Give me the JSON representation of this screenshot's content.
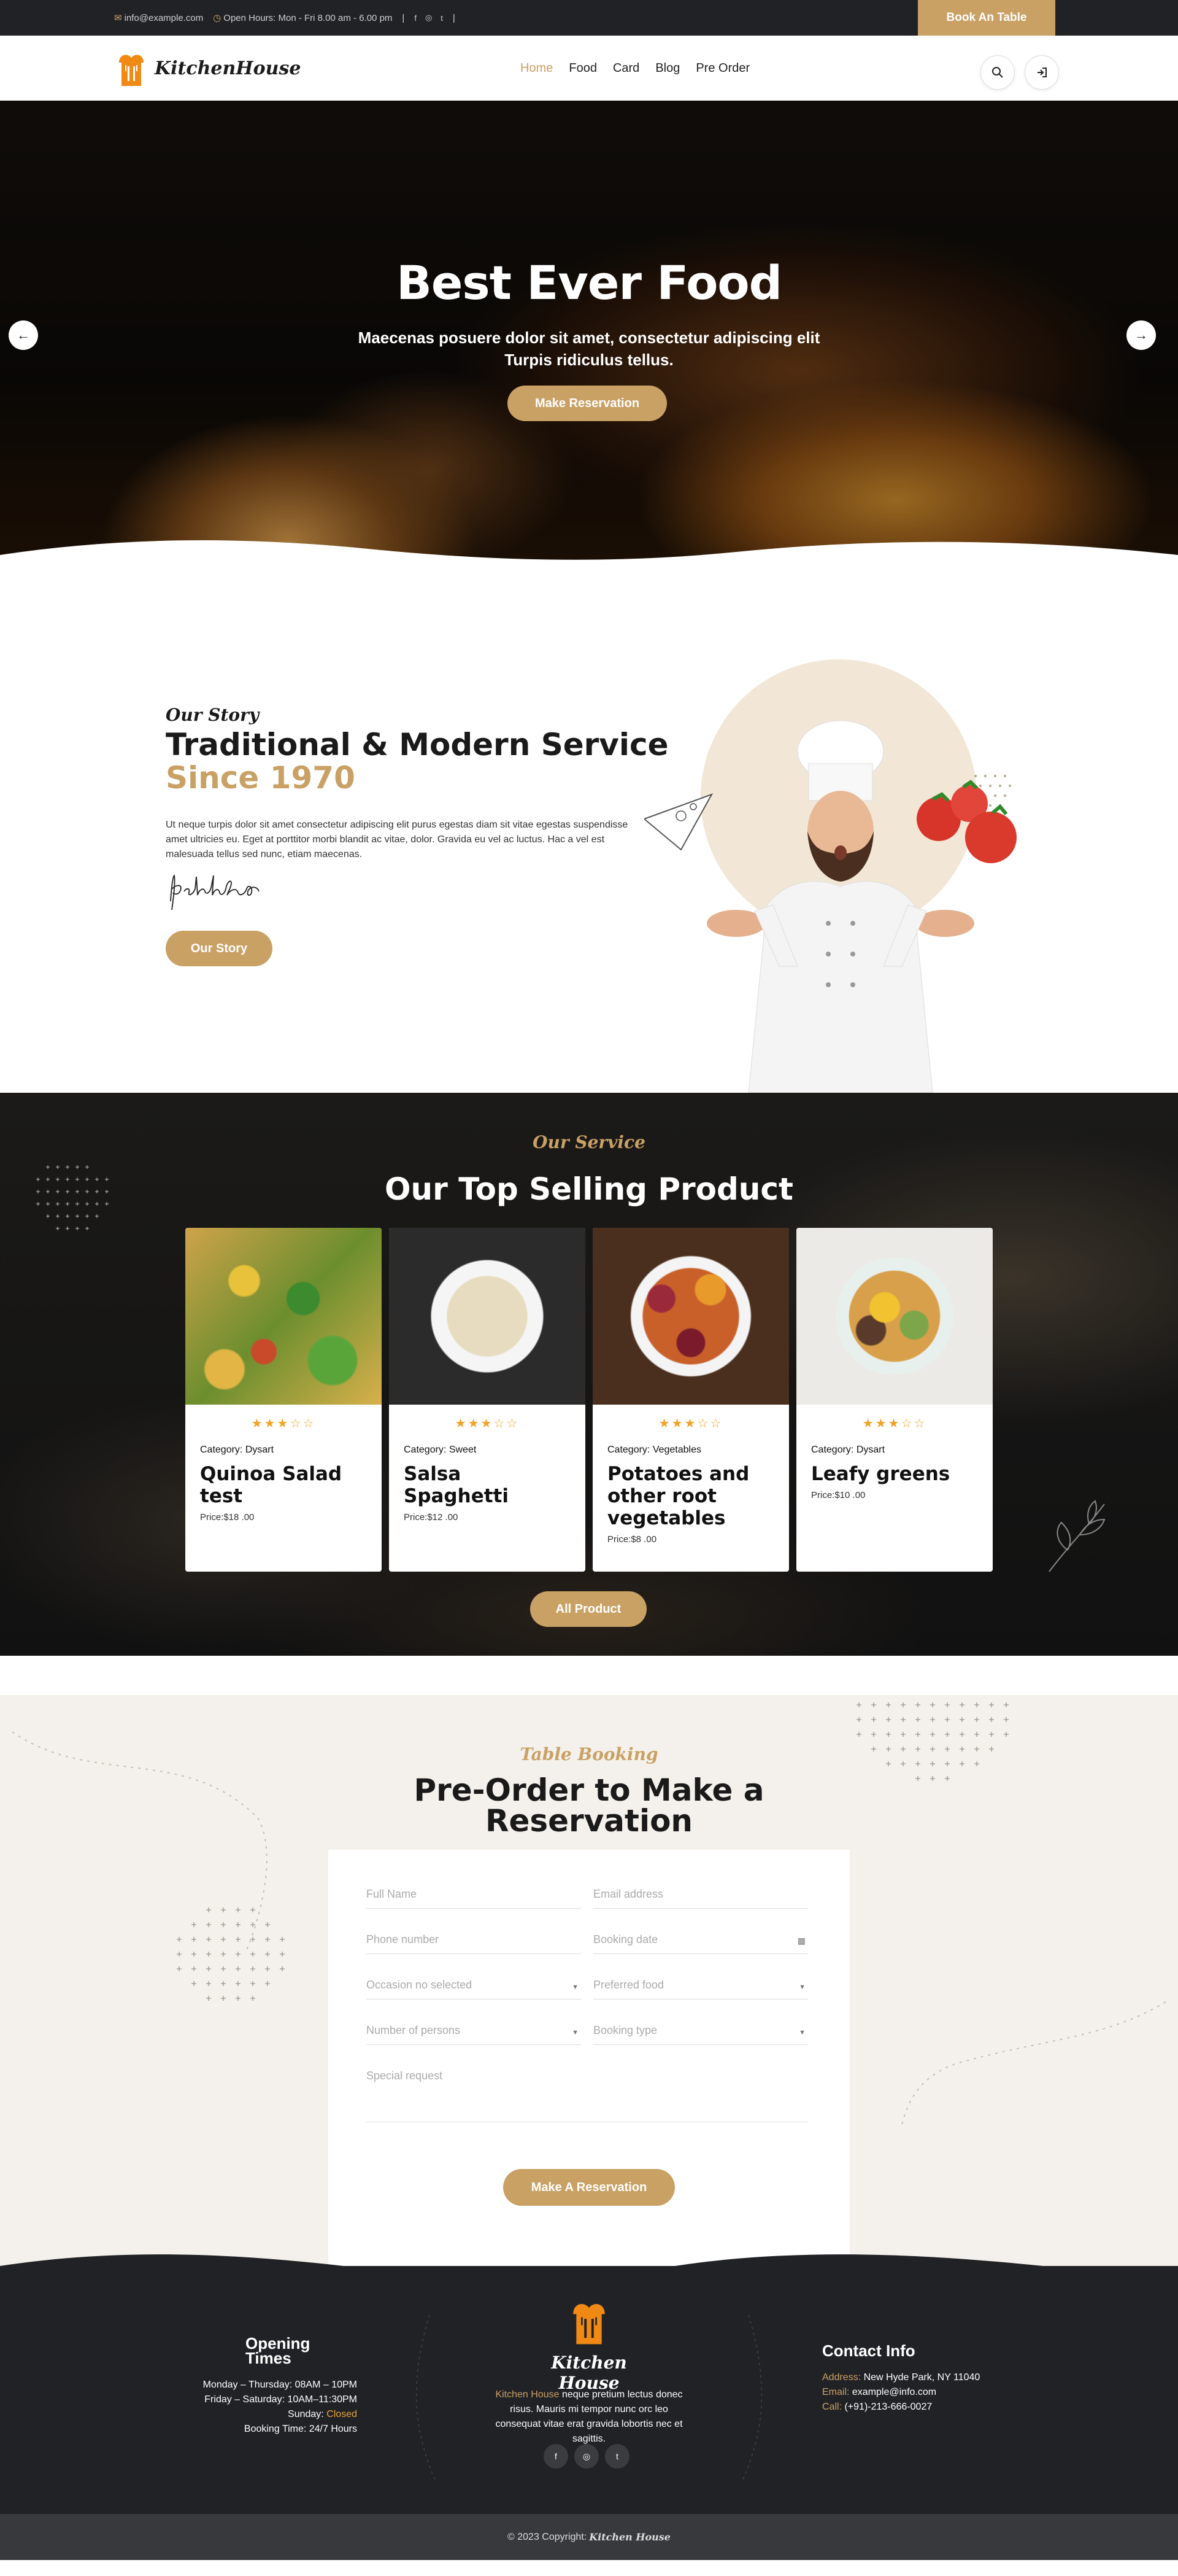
{
  "topbar": {
    "email": "info@example.com",
    "hours": "Open Hours: Mon - Fri 8.00 am - 6.00 pm",
    "socials": [
      "f",
      "◎",
      "t"
    ],
    "divider": "|",
    "book_label": "Book An Table"
  },
  "nav": {
    "brand": "KitchenHouse",
    "items": [
      {
        "label": "Home",
        "active": true
      },
      {
        "label": "Food",
        "active": false
      },
      {
        "label": "Card",
        "active": false
      },
      {
        "label": "Blog",
        "active": false
      },
      {
        "label": "Pre Order",
        "active": false
      }
    ],
    "search_icon": "search-icon",
    "login_icon": "login-icon"
  },
  "hero": {
    "title": "Best Ever Food",
    "text": "Maecenas posuere dolor sit amet, consectetur adipiscing elit Turpis ridiculus tellus.",
    "cta": "Make Reservation",
    "prev": "←",
    "next": "→"
  },
  "story": {
    "subtitle": "Our Story",
    "title_line1": "Traditional & Modern Service",
    "title_line2": "Since 1970",
    "paragraph": "Ut neque turpis dolor sit amet consectetur adipiscing elit purus egestas diam sit vitae egestas suspendisse amet ultricies eu. Eget at porttitor morbi blandit ac vitae, dolor. Gravida eu vel ac luctus. Hac a vel est malesuada tellus sed nunc, etiam maecenas.",
    "button": "Our Story"
  },
  "products": {
    "subtitle": "Our Service",
    "title": "Our Top Selling Product",
    "rating_stars": "★★★☆☆",
    "items": [
      {
        "category": "Category: Dysart",
        "name": "Quinoa Salad test",
        "price": "Price:$18 .00"
      },
      {
        "category": "Category: Sweet",
        "name": "Salsa Spaghetti",
        "price": "Price:$12 .00"
      },
      {
        "category": "Category: Vegetables",
        "name": "Potatoes and other root vegetables",
        "price": "Price:$8 .00"
      },
      {
        "category": "Category: Dysart",
        "name": "Leafy greens",
        "price": "Price:$10 .00"
      }
    ],
    "all_button": "All Product"
  },
  "booking": {
    "subtitle": "Table Booking",
    "title_line1": "Pre-Order to Make a",
    "title_line2": "Reservation",
    "fields": {
      "full_name": "Full Name",
      "email": "Email address",
      "phone": "Phone number",
      "date": "Booking date",
      "occasion": "Occasion no selected",
      "food": "Preferred food",
      "persons": "Number of persons",
      "type": "Booking type",
      "request": "Special request"
    },
    "submit": "Make A Reservation"
  },
  "footer": {
    "opening": {
      "title": "Opening Times",
      "line1": "Monday – Thursday: 08AM – 10PM",
      "line2": "Friday – Saturday: 10AM–11:30PM",
      "line3_label": "Sunday:",
      "line3_value": "Closed",
      "line4": "Booking Time: 24/7 Hours"
    },
    "brand": "Kitchen House",
    "about_highlight": "Kitchen House",
    "about_text": "neque pretium lectus donec risus. Mauris mi tempor nunc orc leo consequat vitae erat gravida lobortis nec et sagittis.",
    "contact": {
      "title": "Contact Info",
      "address_label": "Address:",
      "address": "New Hyde Park, NY 11040",
      "email_label": "Email:",
      "email": "example@info.com",
      "call_label": "Call:",
      "call": "(+91)-213-666-0027"
    },
    "socials": [
      "f",
      "◎",
      "t"
    ],
    "copyright": "© 2023 Copyright:",
    "copyright_brand": "Kitchen House"
  }
}
